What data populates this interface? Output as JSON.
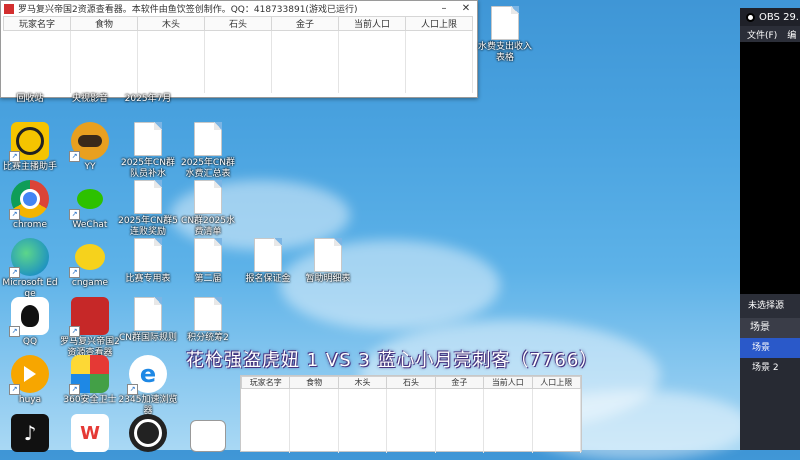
{
  "resource_window": {
    "title": "罗马复兴帝国2资源查看器。本软件由鱼饮签创制作。QQ：418733891(游戏已运行)",
    "columns": [
      "玩家名字",
      "食物",
      "木头",
      "石头",
      "金子",
      "当前人口",
      "人口上限"
    ]
  },
  "desktop": {
    "top_labels": [
      "回收站",
      "央视影音",
      "2025年7月"
    ],
    "icons": [
      {
        "label": "比赛主播助手"
      },
      {
        "label": "YY"
      },
      {
        "label": "2025年CN群队员补水"
      },
      {
        "label": "2025年CN群水费汇总表"
      },
      {
        "label": "chrome"
      },
      {
        "label": "WeChat"
      },
      {
        "label": "2025年CN群5连败奖励"
      },
      {
        "label": "CN群2025水费清单"
      },
      {
        "label": "Microsoft Edge"
      },
      {
        "label": "cngame"
      },
      {
        "label": "比赛专用表"
      },
      {
        "label": "第二届"
      },
      {
        "label": "报名保证金"
      },
      {
        "label": "暂助明细表"
      },
      {
        "label": "QQ"
      },
      {
        "label": "罗马复兴帝国2资源查看器"
      },
      {
        "label": "CN群国际规则"
      },
      {
        "label": "积分统筹2"
      },
      {
        "label": "huya"
      },
      {
        "label": "360安全卫士"
      },
      {
        "label": "2345加速浏览器"
      },
      {
        "label": ""
      },
      {
        "label": ""
      },
      {
        "label": ""
      },
      {
        "label": ""
      }
    ],
    "top_right_file": "水费支出收入表格"
  },
  "obs": {
    "title": "OBS 29.",
    "menu": [
      "文件(F)",
      "编"
    ],
    "no_source": "未选择源",
    "scenes_header": "场景",
    "scenes": [
      "场景",
      "场景 2"
    ]
  },
  "caption": "花枪强盗虎妞 1 VS  3 蓝心小月亮刺客（7766）",
  "bottom_table": {
    "columns": [
      "玩家名字",
      "食物",
      "木头",
      "石头",
      "金子",
      "当前人口",
      "人口上限"
    ]
  },
  "colors": {
    "obs_selected": "#2a59c9",
    "desktop_sky": "#4aa3e0"
  }
}
